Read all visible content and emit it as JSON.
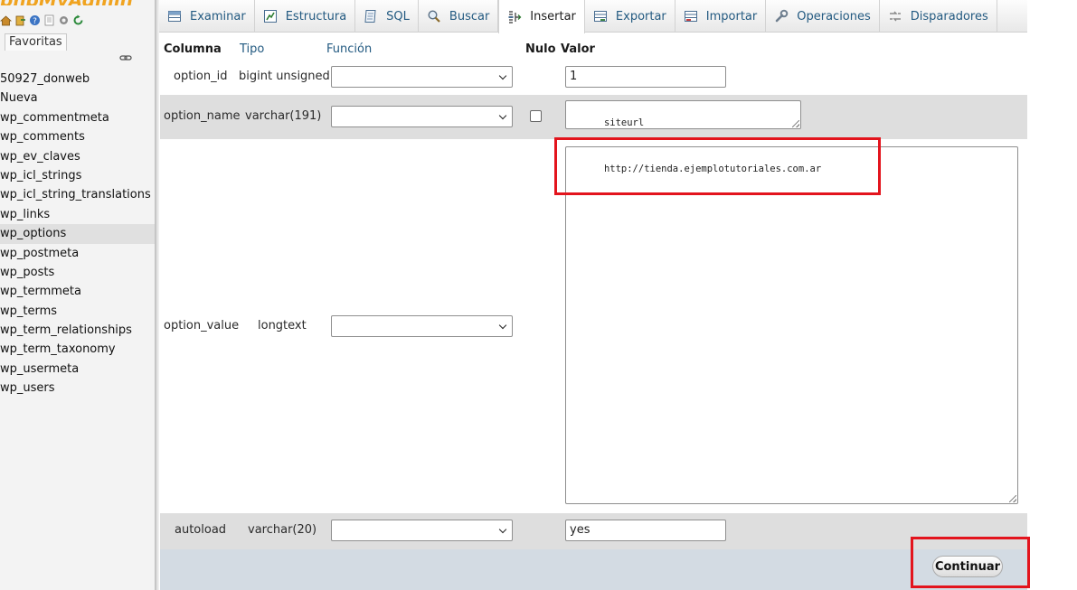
{
  "sidebar": {
    "logo_text": "phpMyAdmin",
    "favorites_tab": "Favoritas",
    "items": [
      {
        "label": "50927_donweb"
      },
      {
        "label": "Nueva"
      },
      {
        "label": "wp_commentmeta"
      },
      {
        "label": "wp_comments"
      },
      {
        "label": "wp_ev_claves"
      },
      {
        "label": "wp_icl_strings"
      },
      {
        "label": "wp_icl_string_translations"
      },
      {
        "label": "wp_links"
      },
      {
        "label": "wp_options"
      },
      {
        "label": "wp_postmeta"
      },
      {
        "label": "wp_posts"
      },
      {
        "label": "wp_termmeta"
      },
      {
        "label": "wp_terms"
      },
      {
        "label": "wp_term_relationships"
      },
      {
        "label": "wp_term_taxonomy"
      },
      {
        "label": "wp_usermeta"
      },
      {
        "label": "wp_users"
      }
    ],
    "selected_item": "wp_options"
  },
  "tabs": [
    {
      "label": "Examinar",
      "icon": "browse-table-icon"
    },
    {
      "label": "Estructura",
      "icon": "structure-icon"
    },
    {
      "label": "SQL",
      "icon": "sql-document-icon"
    },
    {
      "label": "Buscar",
      "icon": "magnifier-icon"
    },
    {
      "label": "Insertar",
      "icon": "insert-row-icon",
      "active": true
    },
    {
      "label": "Exportar",
      "icon": "export-icon"
    },
    {
      "label": "Importar",
      "icon": "import-icon"
    },
    {
      "label": "Operaciones",
      "icon": "wrench-icon"
    },
    {
      "label": "Disparadores",
      "icon": "triggers-icon"
    }
  ],
  "form": {
    "headers": {
      "column": "Columna",
      "type": "Tipo",
      "function": "Función",
      "null": "Nulo",
      "value": "Valor"
    },
    "rows": [
      {
        "column": "option_id",
        "type": "bigint unsigned",
        "function": "",
        "value": "1"
      },
      {
        "column": "option_name",
        "type": "varchar(191)",
        "function": "",
        "null_checked": false,
        "value": "siteurl"
      },
      {
        "column": "option_value",
        "type": "longtext",
        "function": "",
        "value": "http://tienda.ejemplotutoriales.com.ar"
      },
      {
        "column": "autoload",
        "type": "varchar(20)",
        "function": "",
        "value": "yes"
      }
    ],
    "submit_label": "Continuar"
  },
  "colors": {
    "highlight": "#e3141d",
    "link": "#235a81",
    "footer_bar": "#d3dbe3"
  }
}
